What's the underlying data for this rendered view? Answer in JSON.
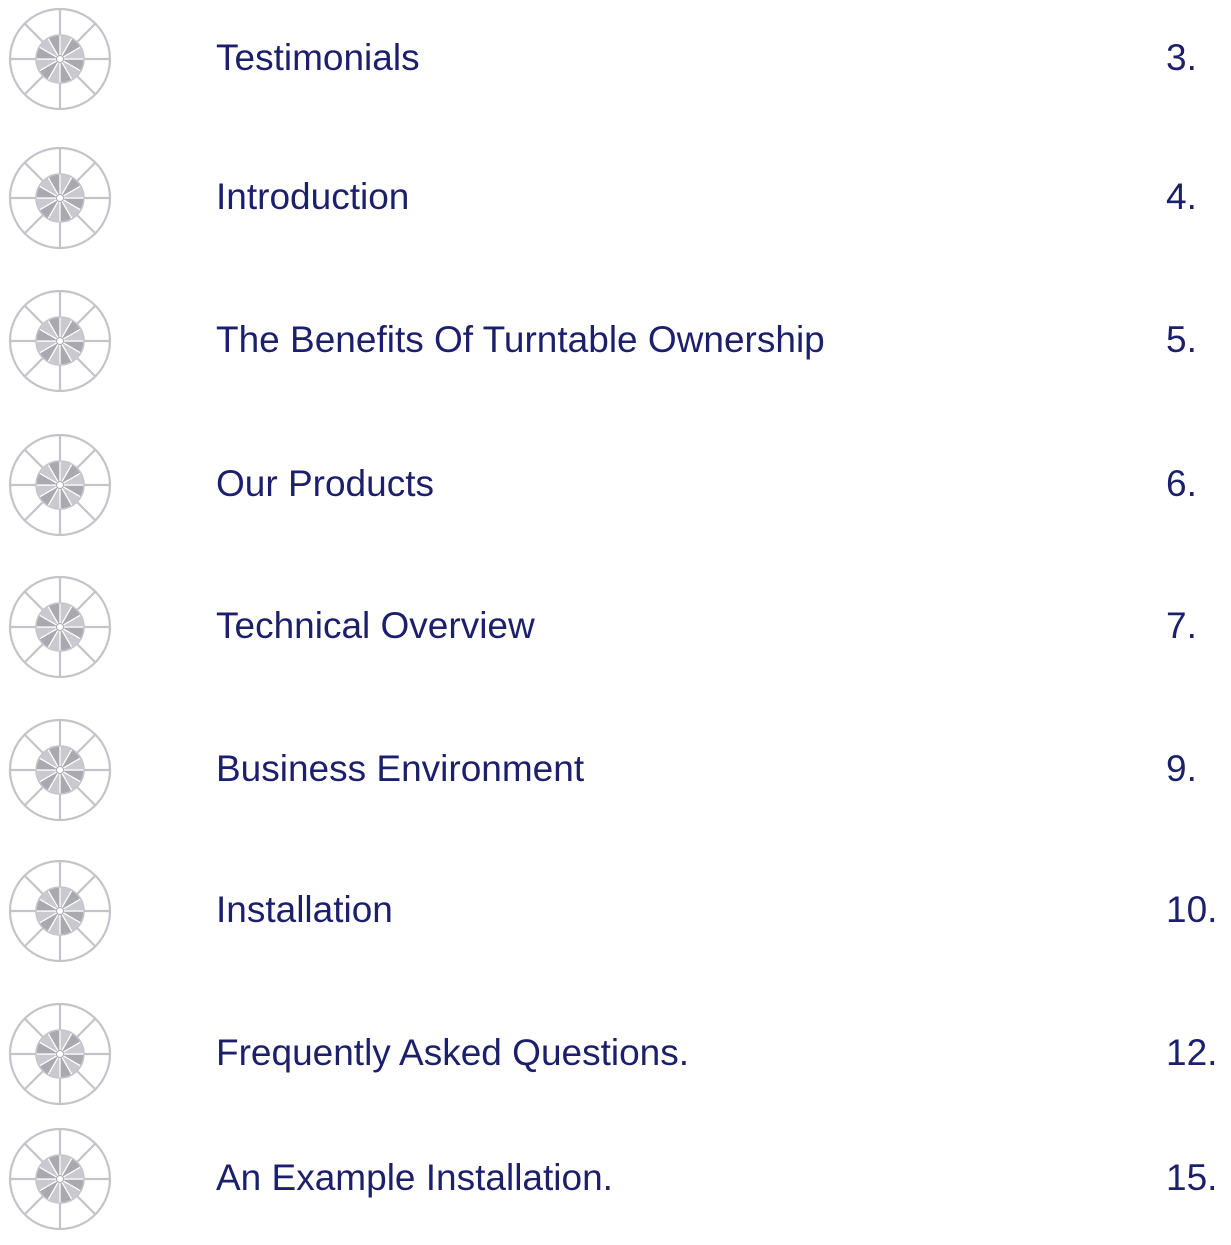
{
  "colors": {
    "text": "#1c1f6b",
    "icon_outline": "#c3c3c9",
    "icon_hub": "#a9a9b0"
  },
  "bullet_icon": "turntable-wheel-icon",
  "toc": {
    "entries": [
      {
        "title": "Testimonials",
        "page": "3."
      },
      {
        "title": "Introduction",
        "page": "4."
      },
      {
        "title": "The Benefits Of Turntable Ownership",
        "page": "5."
      },
      {
        "title": "Our Products",
        "page": "6."
      },
      {
        "title": "Technical Overview",
        "page": "7."
      },
      {
        "title": "Business Environment",
        "page": "9."
      },
      {
        "title": "Installation",
        "page": "10."
      },
      {
        "title": "Frequently Asked Questions.",
        "page": "12."
      },
      {
        "title": "An Example Installation.",
        "page": "15."
      }
    ]
  }
}
